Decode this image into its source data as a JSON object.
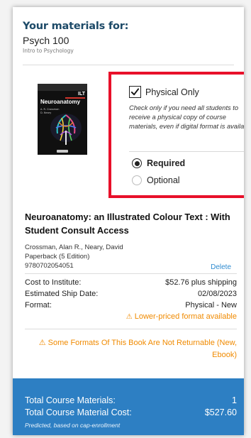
{
  "header": {
    "heading": "Your materials for:",
    "course_code": "Psych 100",
    "course_name": "Intro to Psychology"
  },
  "book_cover": {
    "edition_mark": "ILT",
    "title": "Neuroanatomy",
    "authors_line_1": "A. R. Crossman",
    "authors_line_2": "D. Neary"
  },
  "options": {
    "physical_only_label": "Physical Only",
    "physical_only_checked": true,
    "physical_only_desc": "Check only if you need all students to receive a physical copy of course materials, even if digital format is available",
    "required_label": "Required",
    "optional_label": "Optional",
    "selected": "Required",
    "highlight_color": "#e8102a"
  },
  "book": {
    "title": "Neuroanatomy: an Illustrated Colour Text : With Student Consult Access",
    "authors": "Crossman, Alan R., Neary, David",
    "binding": "Paperback (5 Edition)",
    "isbn": "9780702054051",
    "delete_label": "Delete"
  },
  "costs": {
    "cost_label": "Cost to Institute:",
    "cost_value": "$52.76 plus shipping",
    "ship_label": "Estimated Ship Date:",
    "ship_value": "02/08/2023",
    "format_label": "Format:",
    "format_value": "Physical - New",
    "lower_price_warning": "Lower-priced format available",
    "not_returnable_warning": "⚠ Some Formats Of This Book Are Not Returnable (New, Ebook)",
    "warning_color": "#f08a00"
  },
  "footer": {
    "total_materials_label": "Total Course Materials:",
    "total_materials_value": "1",
    "total_cost_label": "Total Course Material Cost:",
    "total_cost_value": "$527.60",
    "note": "Predicted, based on cap-enrollment",
    "background_color": "#2d7fc3"
  },
  "icons": {
    "checkbox": "check-icon",
    "warning": "warning-icon"
  }
}
